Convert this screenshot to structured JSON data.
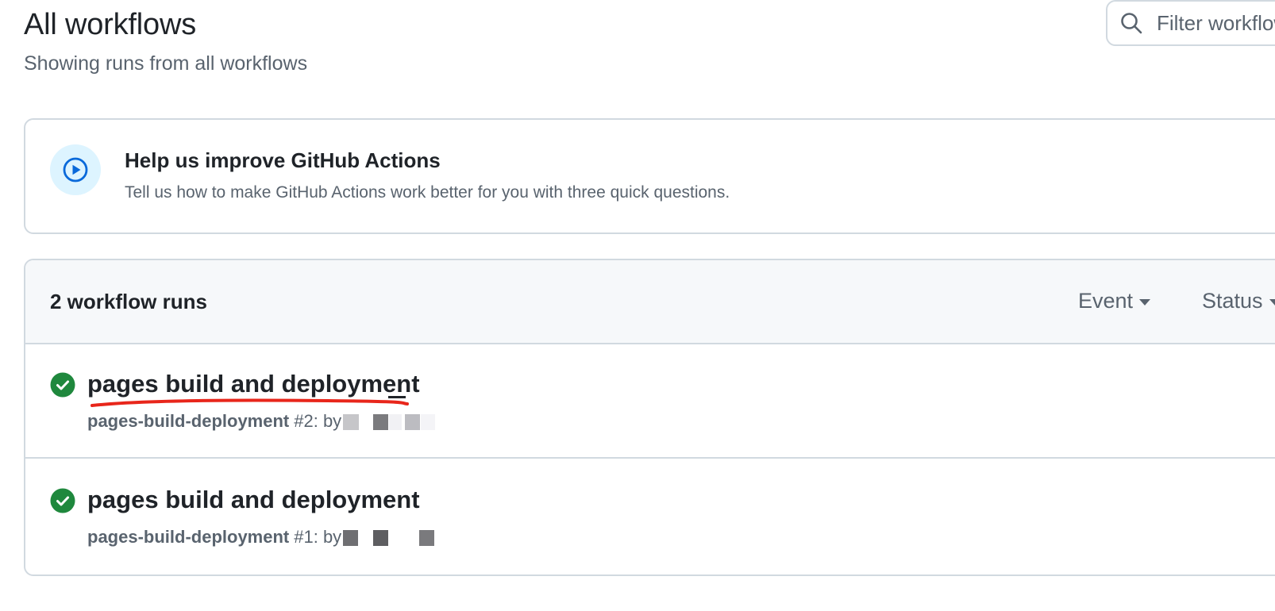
{
  "header": {
    "title": "All workflows",
    "subtitle": "Showing runs from all workflows"
  },
  "search": {
    "placeholder": "Filter workflow runs"
  },
  "banner": {
    "title": "Help us improve GitHub Actions",
    "description": "Tell us how to make GitHub Actions work better for you with three quick questions."
  },
  "runs": {
    "count_label": "2 workflow runs",
    "filters": {
      "event": "Event",
      "status": "Status"
    },
    "items": [
      {
        "title": "pages build and deployment",
        "workflow": "pages-build-deployment",
        "run_number": "#2: by",
        "status": "success"
      },
      {
        "title": "pages build and deployment",
        "workflow": "pages-build-deployment",
        "run_number": "#1: by",
        "status": "success"
      }
    ]
  },
  "colors": {
    "success": "#1f883d",
    "accent_blue": "#0969da",
    "annotation_red": "#e8261b",
    "muted_text": "#59636e",
    "border": "#d1d9e0"
  }
}
